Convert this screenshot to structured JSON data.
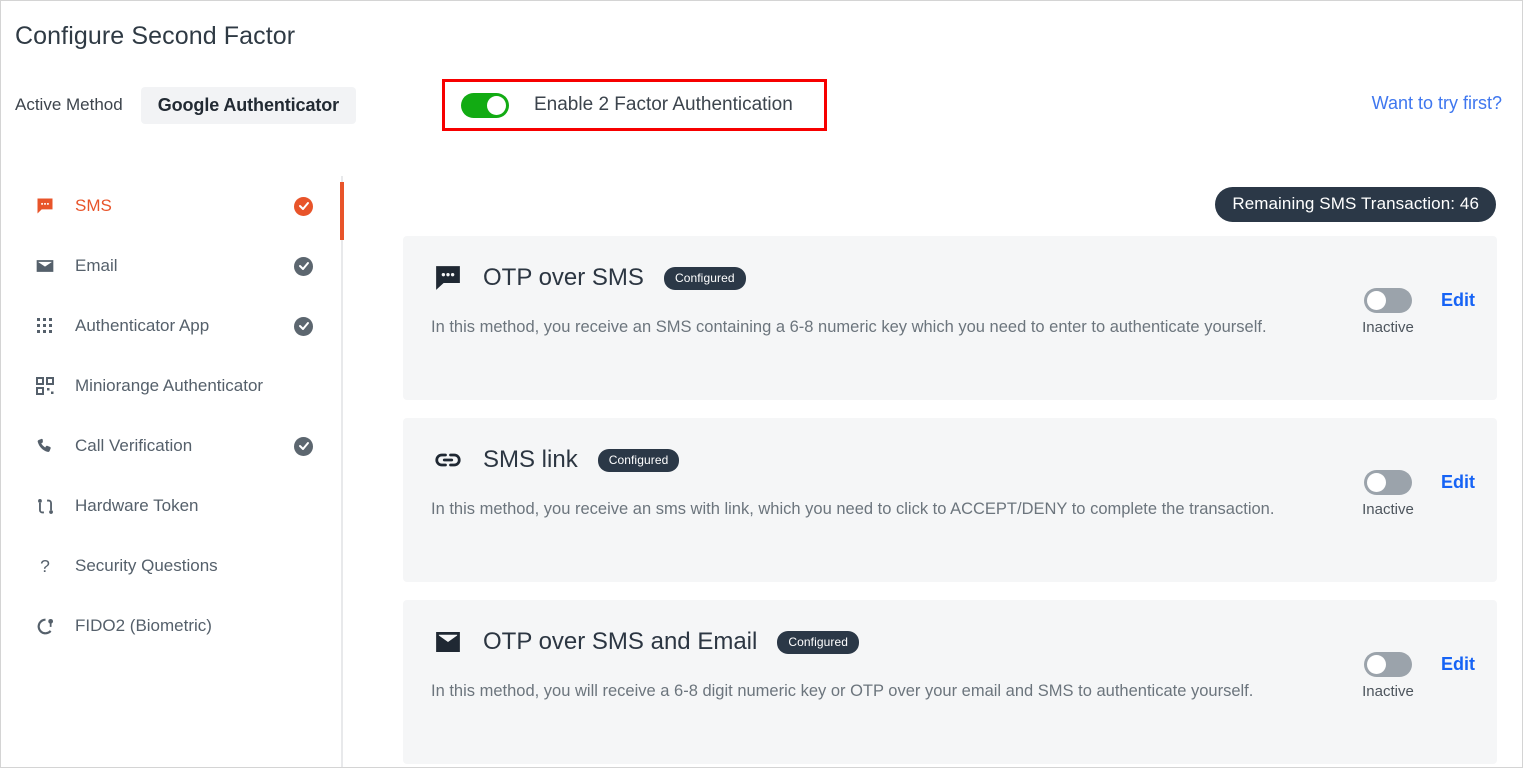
{
  "header": {
    "title": "Configure Second Factor",
    "active_method_label": "Active Method",
    "active_method_value": "Google Authenticator",
    "enable_2fa_label": "Enable 2 Factor Authentication",
    "enable_2fa_state": "on",
    "try_first_link": "Want to try first?",
    "highlight_color": "#f70000",
    "toggle_on_color": "#12ab13",
    "link_color": "#3f77ef"
  },
  "sidebar": {
    "accent_color": "#e8542a",
    "items": [
      {
        "label": "SMS",
        "icon": "sms-bubble-icon",
        "active": true,
        "configured": true
      },
      {
        "label": "Email",
        "icon": "envelope-icon",
        "active": false,
        "configured": true
      },
      {
        "label": "Authenticator App",
        "icon": "grid-dots-icon",
        "active": false,
        "configured": true
      },
      {
        "label": "Miniorange Authenticator",
        "icon": "qr-code-icon",
        "active": false,
        "configured": false
      },
      {
        "label": "Call Verification",
        "icon": "phone-icon",
        "active": false,
        "configured": true
      },
      {
        "label": "Hardware Token",
        "icon": "hardware-token-icon",
        "active": false,
        "configured": false
      },
      {
        "label": "Security Questions",
        "icon": "question-mark-icon",
        "active": false,
        "configured": false
      },
      {
        "label": "FIDO2 (Biometric)",
        "icon": "fido2-key-icon",
        "active": false,
        "configured": false
      }
    ]
  },
  "main": {
    "sms_transaction_pill": "Remaining SMS Transaction: 46",
    "badge_color": "#2b3847",
    "edit_link_color": "#1663f5",
    "cards": [
      {
        "icon": "sms-bubble-icon",
        "title": "OTP over SMS",
        "badge": "Configured",
        "description": "In this method, you receive an SMS containing a 6-8 numeric key which you need to enter to authenticate yourself.",
        "toggle_state": "off",
        "toggle_caption": "Inactive",
        "edit_label": "Edit"
      },
      {
        "icon": "link-chain-icon",
        "title": "SMS link",
        "badge": "Configured",
        "description": "In this method, you receive an sms with link, which you need to click to ACCEPT/DENY to complete the transaction.",
        "toggle_state": "off",
        "toggle_caption": "Inactive",
        "edit_label": "Edit"
      },
      {
        "icon": "envelope-icon",
        "title": "OTP over SMS and Email",
        "badge": "Configured",
        "description": "In this method, you will receive a 6-8 digit numeric key or OTP over your email and SMS to authenticate yourself.",
        "toggle_state": "off",
        "toggle_caption": "Inactive",
        "edit_label": "Edit"
      }
    ]
  }
}
